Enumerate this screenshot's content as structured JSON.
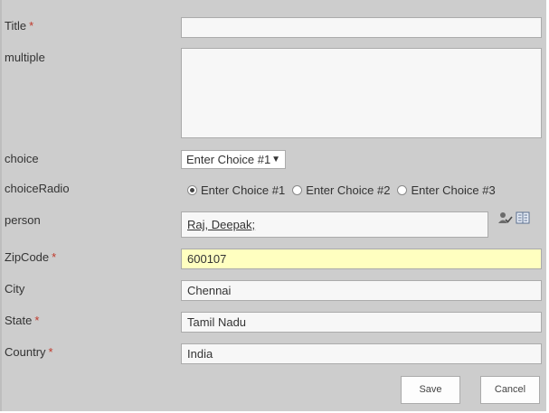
{
  "form": {
    "fields": {
      "title": {
        "label": "Title",
        "required": "*",
        "value": ""
      },
      "multiple": {
        "label": "multiple",
        "value": ""
      },
      "choice": {
        "label": "choice",
        "selected": "Enter Choice #1"
      },
      "choiceRadio": {
        "label": "choiceRadio",
        "options": [
          "Enter Choice #1",
          "Enter Choice #2",
          "Enter Choice #3"
        ],
        "selected_index": 0
      },
      "person": {
        "label": "person",
        "value": "Raj, Deepak;"
      },
      "zipcode": {
        "label": "ZipCode",
        "required": "*",
        "value": "600107"
      },
      "city": {
        "label": "City",
        "value": "Chennai"
      },
      "state": {
        "label": "State",
        "required": "*",
        "value": "Tamil Nadu"
      },
      "country": {
        "label": "Country",
        "required": "*",
        "value": "India"
      }
    },
    "buttons": {
      "save": "Save",
      "cancel": "Cancel"
    }
  },
  "icons": {
    "check_names": "check-names-icon",
    "browse": "address-book-icon"
  },
  "colors": {
    "panel_bg": "#cdcdcd",
    "field_bg": "#f7f7f7",
    "highlight_bg": "#ffffc0",
    "required": "#c0392b"
  }
}
